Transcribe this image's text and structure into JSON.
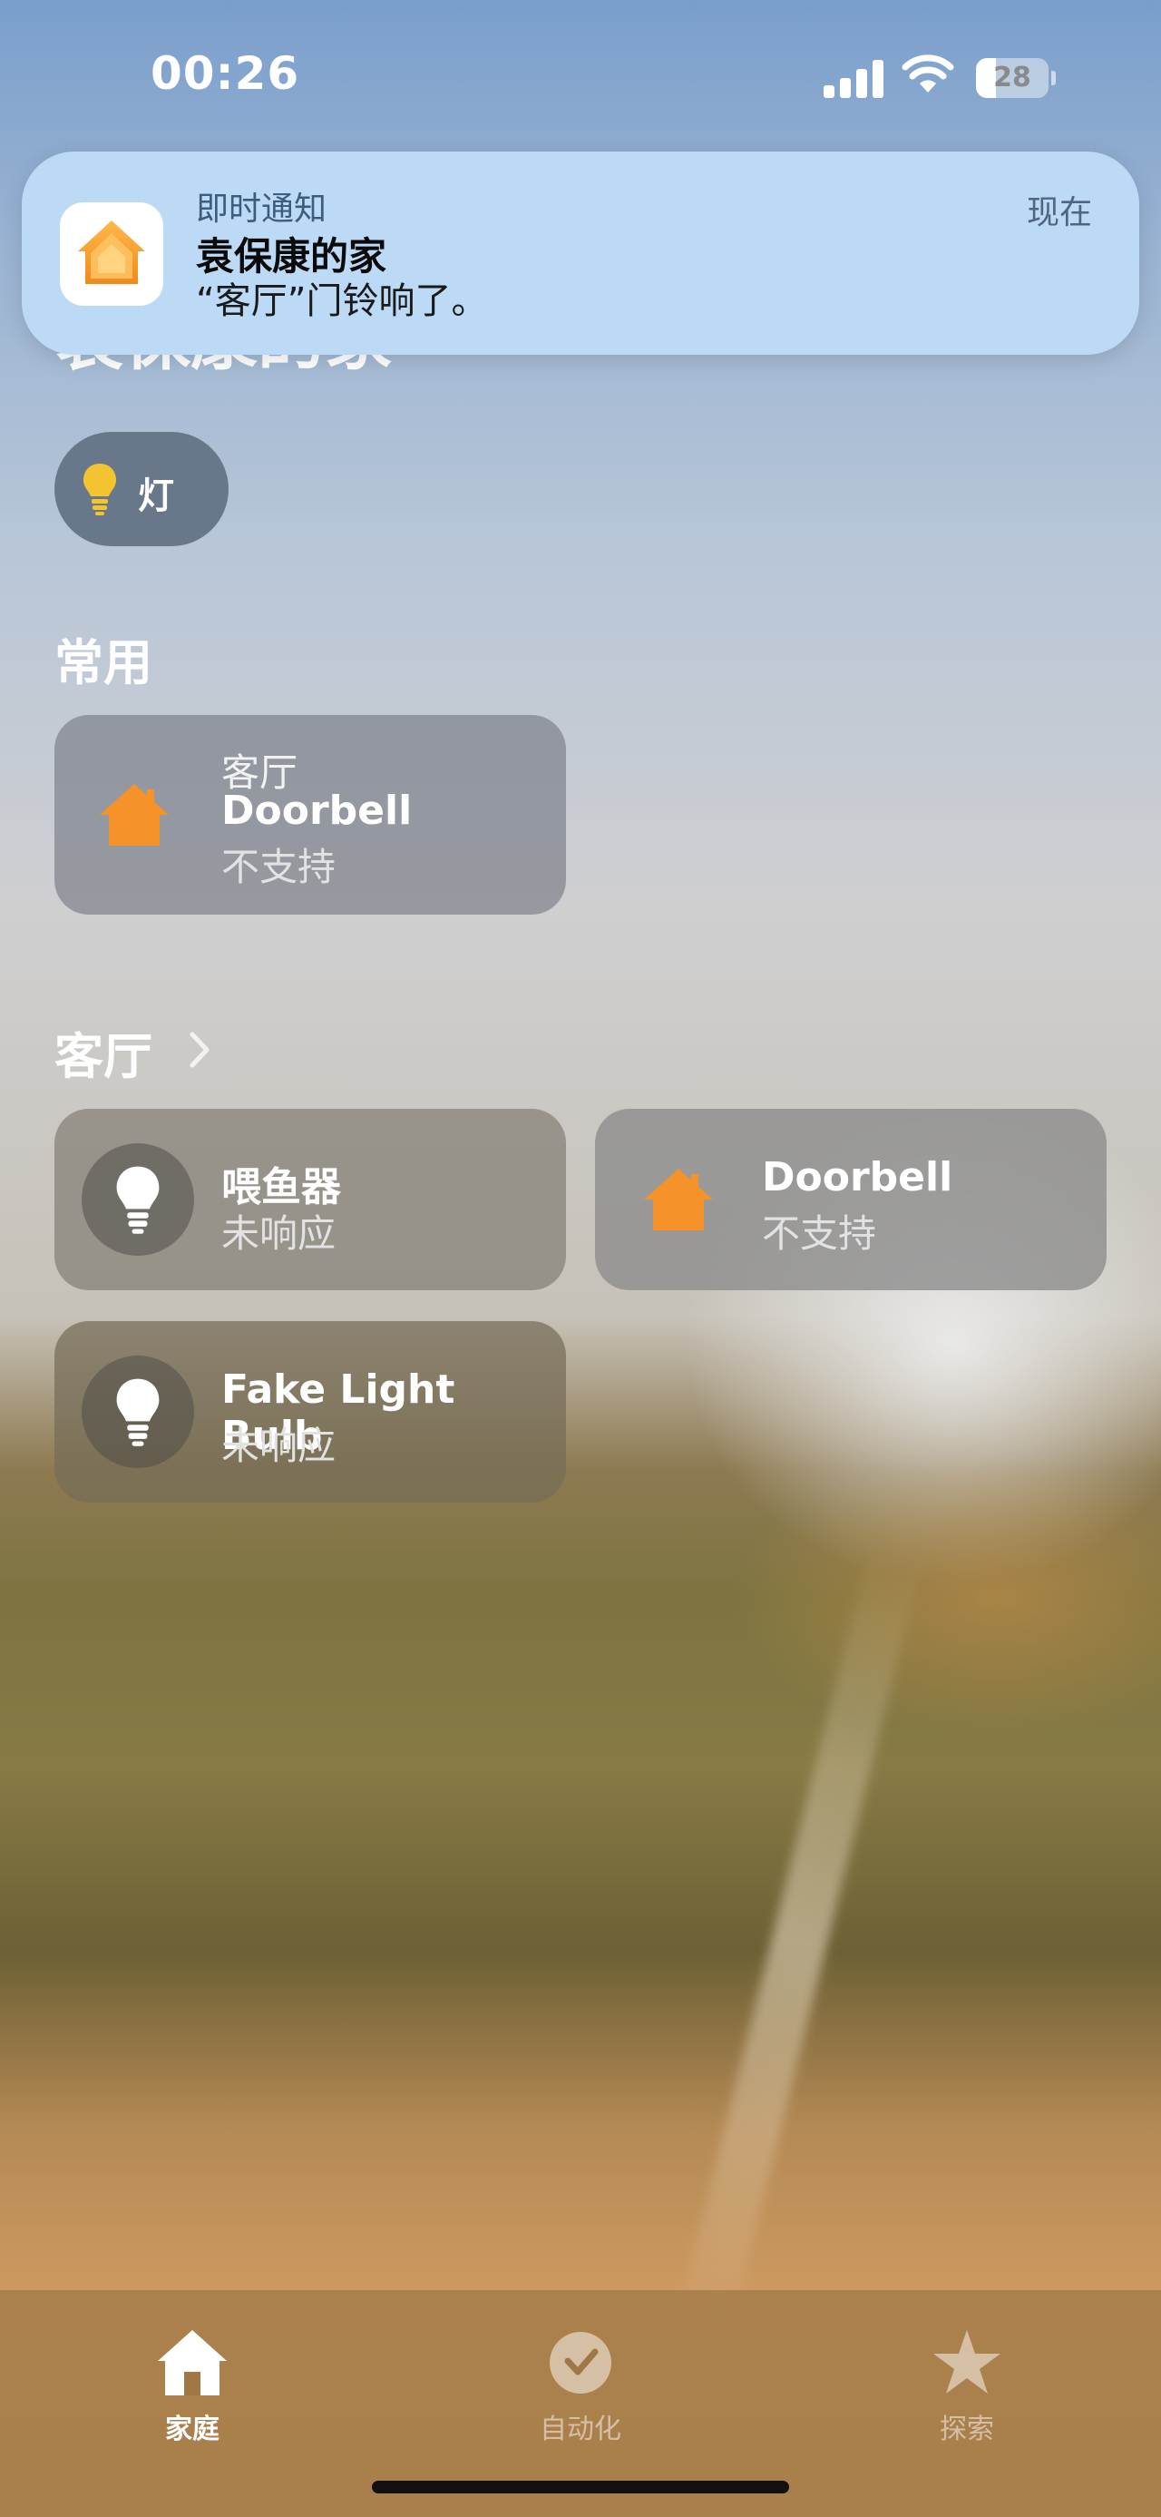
{
  "status_bar": {
    "time": "00:26",
    "battery": "28",
    "battery_level": 0.28
  },
  "home": {
    "title": "袁保康的家"
  },
  "notification": {
    "type": "即时通知",
    "title": "袁保康的家",
    "body": "“客厅”门铃响了。",
    "time": "现在",
    "icon": "home-app-icon"
  },
  "chips": [
    {
      "label": "灯",
      "icon": "lightbulb-icon"
    }
  ],
  "favorites": {
    "title": "常用",
    "tiles": [
      {
        "room": "客厅",
        "name": "Doorbell",
        "status": "不支持",
        "icon": "house-icon"
      }
    ]
  },
  "living_room": {
    "title": "客厅",
    "tiles": [
      {
        "name": "喂鱼器",
        "status": "未响应",
        "icon": "lightbulb-icon"
      },
      {
        "name": "Doorbell",
        "status": "不支持",
        "icon": "house-icon"
      },
      {
        "name": "Fake Light Bulb",
        "status": "未响应",
        "icon": "lightbulb-icon"
      }
    ]
  },
  "tab_bar": {
    "tabs": [
      {
        "label": "家庭",
        "icon": "house-icon",
        "active": true
      },
      {
        "label": "自动化",
        "icon": "clock-check-icon",
        "active": false
      },
      {
        "label": "探索",
        "icon": "star-icon",
        "active": false
      }
    ]
  },
  "colors": {
    "accent_orange": "#f5922a",
    "bulb_yellow": "#f4c430"
  }
}
